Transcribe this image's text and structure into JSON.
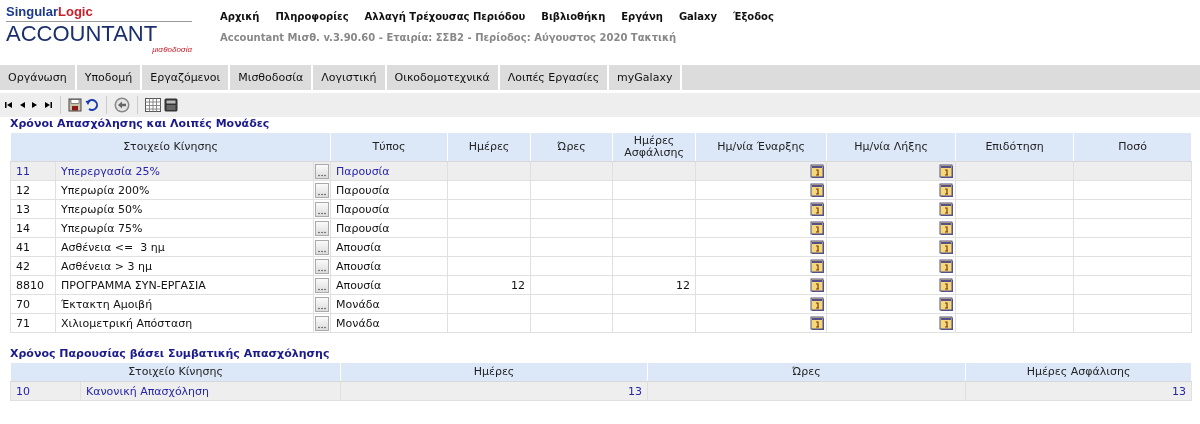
{
  "logo": {
    "brand_first": "Singular",
    "brand_second": "Logic",
    "product": "ACCOUNTANT",
    "subtitle": "μισθοδοσία"
  },
  "top_menu": [
    "Αρχική",
    "Πληροφορίες",
    "Αλλαγή Τρέχουσας Περιόδου",
    "Βιβλιοθήκη",
    "Εργάνη",
    "Galaxy",
    "Έξοδος"
  ],
  "info_line": "Accountant Μισθ. v.3.90.60 - Εταιρία: ΣΣΒ2 - Περίοδος: Αύγουστος 2020 Τακτική",
  "tabs": [
    "Οργάνωση",
    "Υποδομή",
    "Εργαζόμενοι",
    "Μισθοδοσία",
    "Λογιστική",
    "Οικοδομοτεχνικά",
    "Λοιπές Εργασίες",
    "myGalaxy"
  ],
  "units_table": {
    "title": "Χρόνοι Απασχόλησης και Λοιπές Μονάδες",
    "columns": [
      "Στοιχείο Κίνησης",
      "Τύπος",
      "Ημέρες",
      "Ώρες",
      "Ημέρες Ασφάλισης",
      "Ημ/νία Έναρξης",
      "Ημ/νία Λήξης",
      "Επιδότηση",
      "Ποσό"
    ],
    "rows": [
      {
        "code": "11",
        "name": "Υπερεργασία 25%",
        "type": "Παρουσία",
        "days": "",
        "hours": "",
        "insurance_days": "",
        "selected": true
      },
      {
        "code": "12",
        "name": "Υπερωρία 200%",
        "type": "Παρουσία",
        "days": "",
        "hours": "",
        "insurance_days": "",
        "selected": false
      },
      {
        "code": "13",
        "name": "Υπερωρία 50%",
        "type": "Παρουσία",
        "days": "",
        "hours": "",
        "insurance_days": "",
        "selected": false
      },
      {
        "code": "14",
        "name": "Υπερωρία 75%",
        "type": "Παρουσία",
        "days": "",
        "hours": "",
        "insurance_days": "",
        "selected": false
      },
      {
        "code": "41",
        "name": "Ασθένεια <=  3 ημ",
        "type": "Απουσία",
        "days": "",
        "hours": "",
        "insurance_days": "",
        "selected": false
      },
      {
        "code": "42",
        "name": "Ασθένεια > 3 ημ",
        "type": "Απουσία",
        "days": "",
        "hours": "",
        "insurance_days": "",
        "selected": false
      },
      {
        "code": "8810",
        "name": "ΠΡΟΓΡΑΜΜΑ ΣΥΝ-ΕΡΓΑΣΙΑ",
        "type": "Απουσία",
        "days": "12",
        "hours": "",
        "insurance_days": "12",
        "selected": false
      },
      {
        "code": "70",
        "name": "Έκτακτη Αμοιβή",
        "type": "Μονάδα",
        "days": "",
        "hours": "",
        "insurance_days": "",
        "selected": false
      },
      {
        "code": "71",
        "name": "Χιλιομετρική Απόσταση",
        "type": "Μονάδα",
        "days": "",
        "hours": "",
        "insurance_days": "",
        "selected": false
      }
    ]
  },
  "attendance_table": {
    "title": "Χρόνος Παρουσίας βάσει Συμβατικής Απασχόλησης",
    "columns": [
      "Στοιχείο Κίνησης",
      "Ημέρες",
      "Ώρες",
      "Ημέρες Ασφάλισης"
    ],
    "rows": [
      {
        "code": "10",
        "name": "Κανονική Απασχόληση",
        "days": "13",
        "hours": "",
        "insurance_days": "13",
        "selected": true
      }
    ]
  }
}
